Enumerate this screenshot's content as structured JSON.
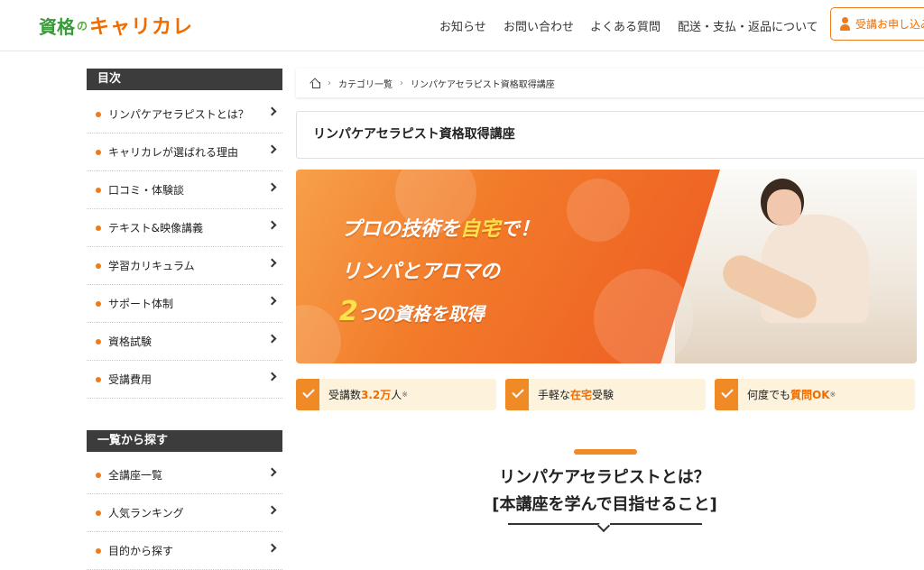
{
  "header": {
    "logo": {
      "part1": "資格",
      "part2": "の",
      "part3": "キャリカレ"
    },
    "nav": [
      "お知らせ",
      "お問い合わせ",
      "よくある質問",
      "配送・支払・返品について"
    ],
    "apply_label": "受講お申し込み"
  },
  "sidebar": {
    "toc_title": "目次",
    "toc_items": [
      "リンパケアセラピストとは？",
      "キャリカレが選ばれる理由",
      "口コミ・体験談",
      "テキスト&映像講義",
      "学習カリキュラム",
      "サポート体制",
      "資格試験",
      "受講費用"
    ],
    "search_title": "一覧から探す",
    "search_items": [
      "全講座一覧",
      "人気ランキング",
      "目的から探す"
    ]
  },
  "breadcrumb": [
    "カテゴリ一覧",
    "リンパケアセラピスト資格取得講座"
  ],
  "page_title": "リンパケアセラピスト資格取得講座",
  "banner": {
    "line1_a": "プロの技術を",
    "line1_b": "自宅",
    "line1_c": "で！",
    "line2": "リンパとアロマの",
    "line3_a": "2",
    "line3_b": "つの資格を取得"
  },
  "features": [
    {
      "pre": "受講数",
      "hl": "3.2万",
      "post": "人",
      "note": "※"
    },
    {
      "pre": "手軽な",
      "hl": "在宅",
      "post": "受験",
      "note": ""
    },
    {
      "pre": "何度でも",
      "hl": "質問OK",
      "post": "",
      "note": "※"
    }
  ],
  "section": {
    "title_line1": "リンパケアセラピストとは？",
    "title_line2": "[本講座を学んで目指せること]"
  },
  "colors": {
    "accent": "#ef6c00",
    "dark": "#3c3c3c",
    "feature_bg": "#fdf3dc"
  }
}
